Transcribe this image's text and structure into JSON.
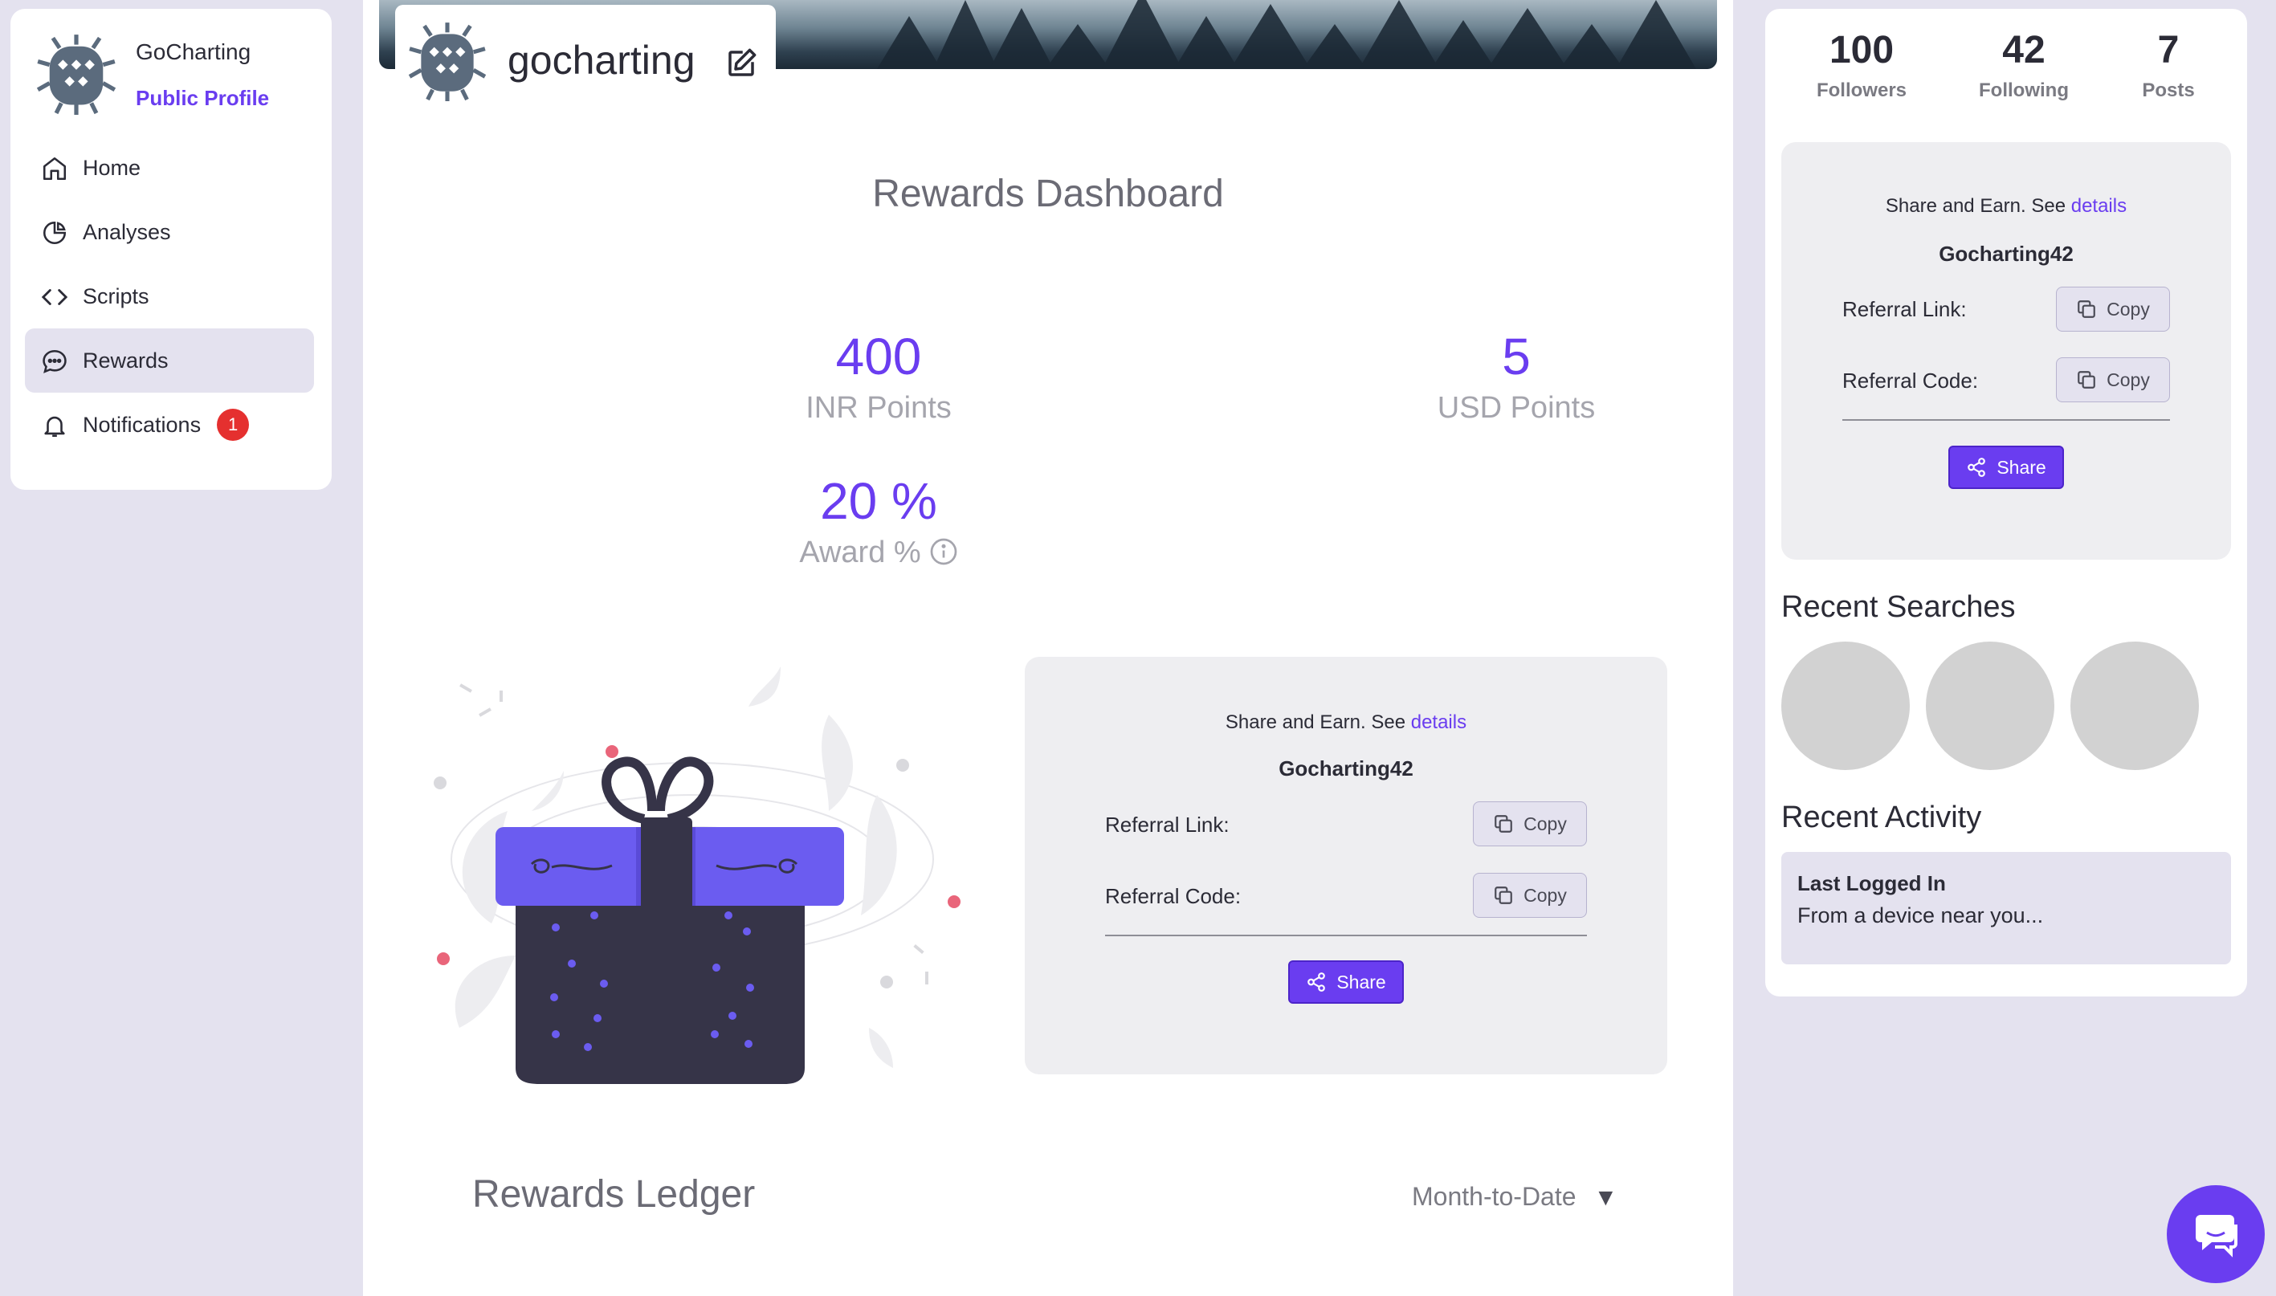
{
  "sidebar": {
    "brand_name": "GoCharting",
    "brand_sub": "Public Profile",
    "items": [
      {
        "label": "Home",
        "icon": "home-icon"
      },
      {
        "label": "Analyses",
        "icon": "pie-chart-icon"
      },
      {
        "label": "Scripts",
        "icon": "code-icon"
      },
      {
        "label": "Rewards",
        "icon": "chat-bubble-icon"
      },
      {
        "label": "Notifications",
        "icon": "bell-icon",
        "badge": "1"
      }
    ]
  },
  "profile": {
    "name": "gocharting"
  },
  "dashboard": {
    "title": "Rewards Dashboard",
    "inr_points": "400",
    "inr_label": "INR Points",
    "usd_points": "5",
    "usd_label": "USD Points",
    "award_pct": "20 %",
    "award_label": "Award %"
  },
  "share": {
    "prefix": "Share and Earn. See",
    "details": "details",
    "code": "Gocharting42",
    "link_label": "Referral Link:",
    "code_label": "Referral Code:",
    "copy": "Copy",
    "share": "Share"
  },
  "ledger": {
    "title": "Rewards Ledger",
    "period": "Month-to-Date"
  },
  "right": {
    "followers": "100",
    "followers_label": "Followers",
    "following": "42",
    "following_label": "Following",
    "posts": "7",
    "posts_label": "Posts",
    "recent_searches": "Recent Searches",
    "recent_activity": "Recent Activity",
    "activity_title": "Last Logged In",
    "activity_desc": "From a device near you..."
  },
  "colors": {
    "accent": "#6a3df0",
    "badge": "#e5302f",
    "background": "#e4e2ef"
  }
}
